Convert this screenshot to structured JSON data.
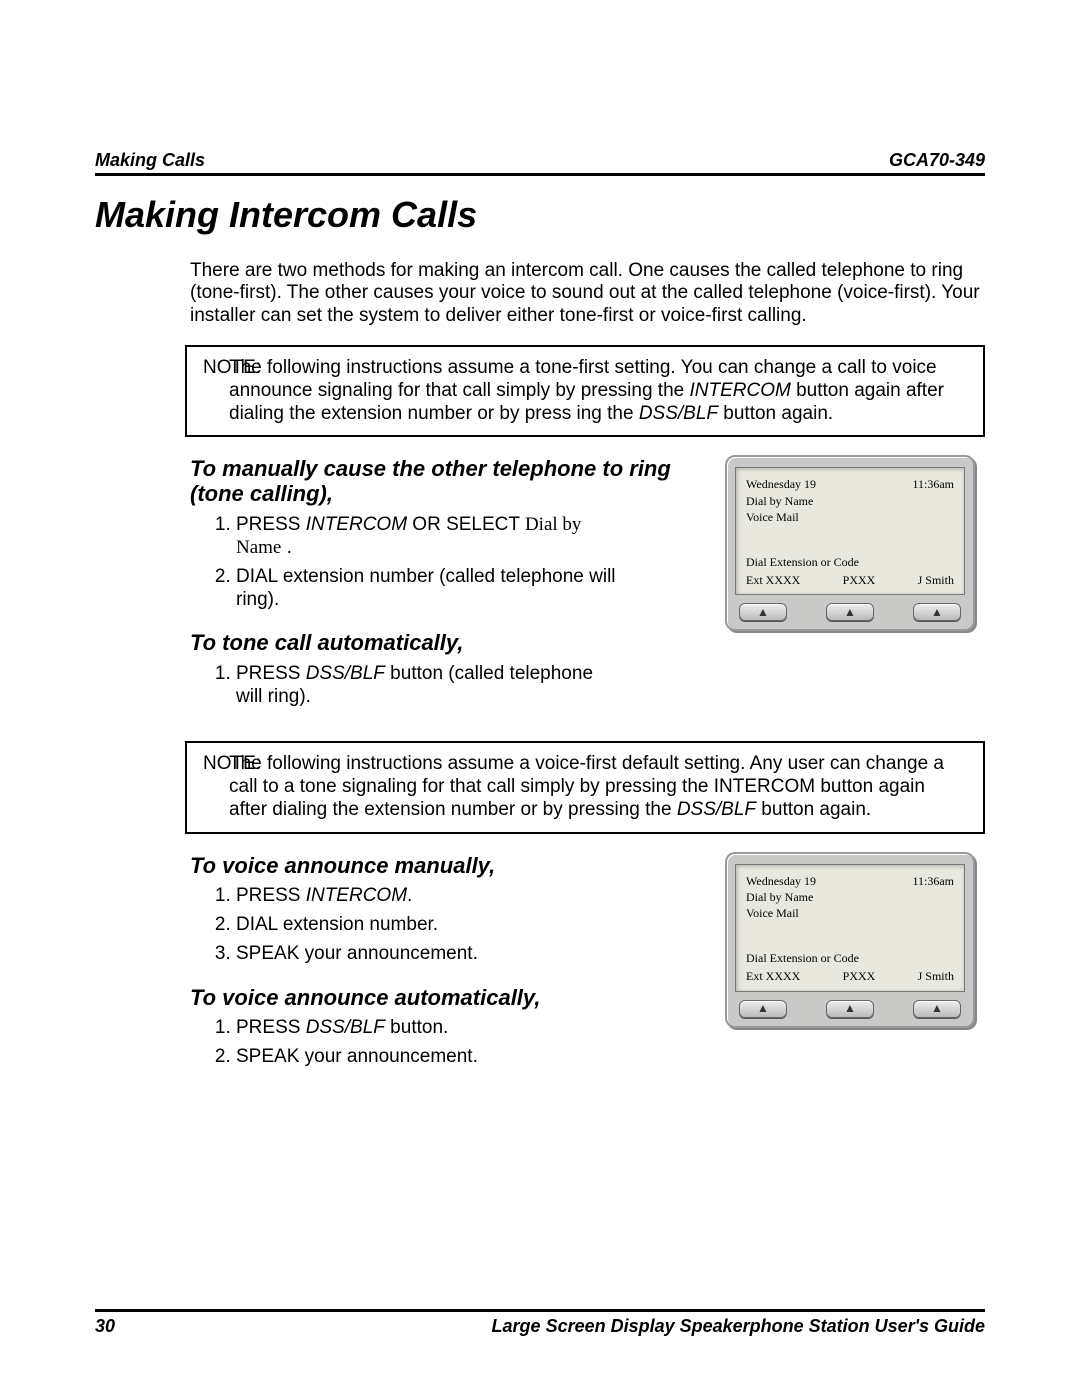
{
  "header": {
    "left": "Making Calls",
    "right": "GCA70-349"
  },
  "title": "Making Intercom Calls",
  "intro": "There are two methods for making an intercom call. One causes the called telephone to ring (tone-first). The other causes your voice to sound out at the called telephone (voice-first). Your installer can set the system to deliver either tone-first or voice-first calling.",
  "note1": {
    "label": "NOTE:",
    "before_i1": "The following instructions assume a tone-first setting. You can change a call to voice announce signaling for that call simply by pressing the ",
    "i1": "INTERCOM",
    "mid": " button again after dialing the extension number or by press ing the ",
    "i2": "DSS/BLF",
    "after": " button again."
  },
  "sec1": {
    "heading": "To manually cause the other telephone to ring (tone calling),",
    "step1_a": "PRESS ",
    "step1_i": "INTERCOM",
    "step1_b": " OR SELECT ",
    "step1_c": "Dial by Name",
    "step1_d": " .",
    "step2": "DIAL  extension number (called telephone will ring)."
  },
  "sec2": {
    "heading": "To tone call automatically,",
    "step1_a": "PRESS ",
    "step1_i": "DSS/BLF",
    "step1_b": " button (called telephone will ring)."
  },
  "note2": {
    "label": "NOTE:",
    "before": "The following instructions assume a voice-first default setting. Any user can change a call to a tone signaling for that call simply by pressing the INTERCOM button again after dialing the extension number or by pressing the ",
    "i1": "DSS/BLF",
    "after": " button again."
  },
  "sec3": {
    "heading": "To voice announce manually,",
    "step1_a": "PRESS ",
    "step1_i": "INTERCOM",
    "step1_b": ".",
    "step2": "DIAL  extension number.",
    "step3": "SPEAK your announcement."
  },
  "sec4": {
    "heading": "To voice announce automatically,",
    "step1_a": "PRESS ",
    "step1_i": "DSS/BLF",
    "step1_b": " button.",
    "step2": "SPEAK your announcement."
  },
  "lcd": {
    "date": "Wednesday 19",
    "time": "11:36am",
    "line1": "Dial by Name",
    "line2": "Voice Mail",
    "prompt": "Dial Extension or Code",
    "soft1": "Ext XXXX",
    "soft2": "PXXX",
    "soft3": "J Smith"
  },
  "softkey_glyph": "▲",
  "footer": {
    "page": "30",
    "title": "Large Screen Display Speakerphone Station User's Guide"
  }
}
